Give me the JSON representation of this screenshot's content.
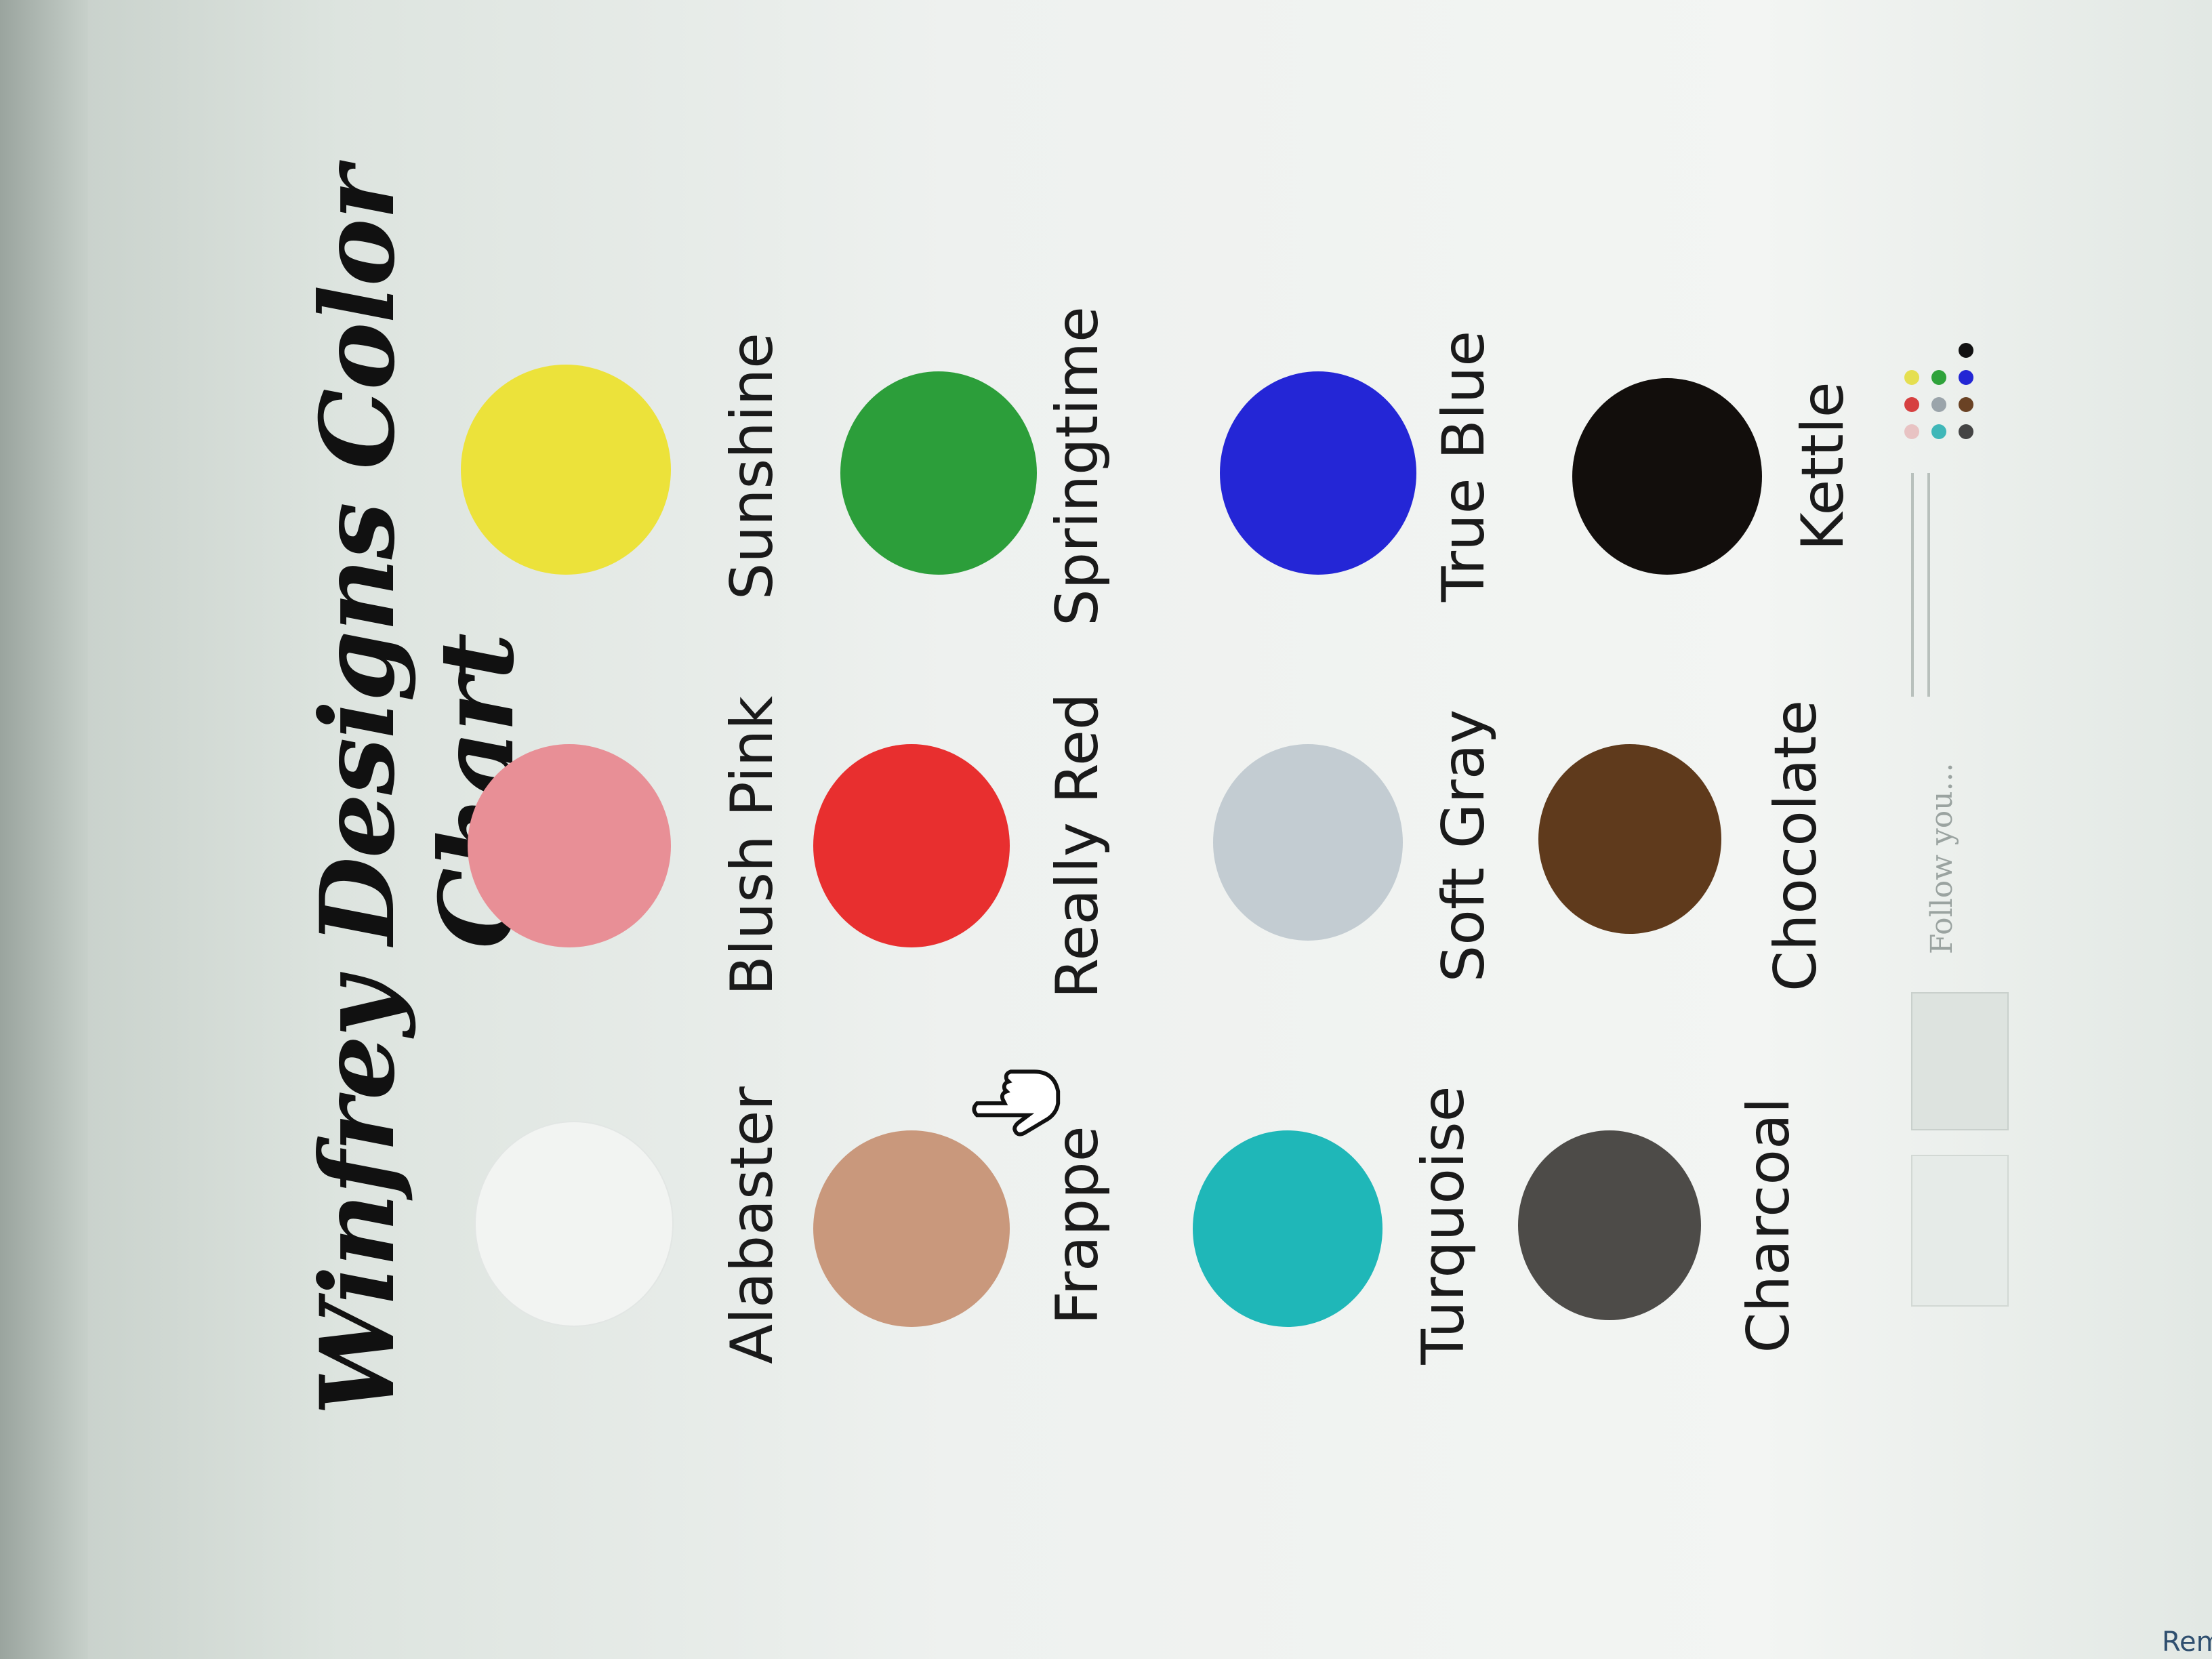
{
  "title": "Winfrey Designs Color Chart",
  "swatches": [
    {
      "name": "Alabaster",
      "color": "#f2f4f2"
    },
    {
      "name": "Blush Pink",
      "color": "#e88f96"
    },
    {
      "name": "Sunshine",
      "color": "#ece23a"
    },
    {
      "name": "Frappe",
      "color": "#c9987c"
    },
    {
      "name": "Really Red",
      "color": "#e82f2f"
    },
    {
      "name": "Springtime",
      "color": "#2c9e3a"
    },
    {
      "name": "Turquoise",
      "color": "#1fb7b8"
    },
    {
      "name": "Soft Gray",
      "color": "#c3ccd2"
    },
    {
      "name": "True Blue",
      "color": "#2426d6"
    },
    {
      "name": "Charcoal",
      "color": "#4d4b48"
    },
    {
      "name": "Chocolate",
      "color": "#5f3a1c"
    },
    {
      "name": "Kettle",
      "color": "#120e0c"
    }
  ],
  "cursor_icon": "hand-pointer-icon",
  "footer": {
    "faded_text": "Follow you..."
  },
  "corner": {
    "text": "Remove"
  }
}
